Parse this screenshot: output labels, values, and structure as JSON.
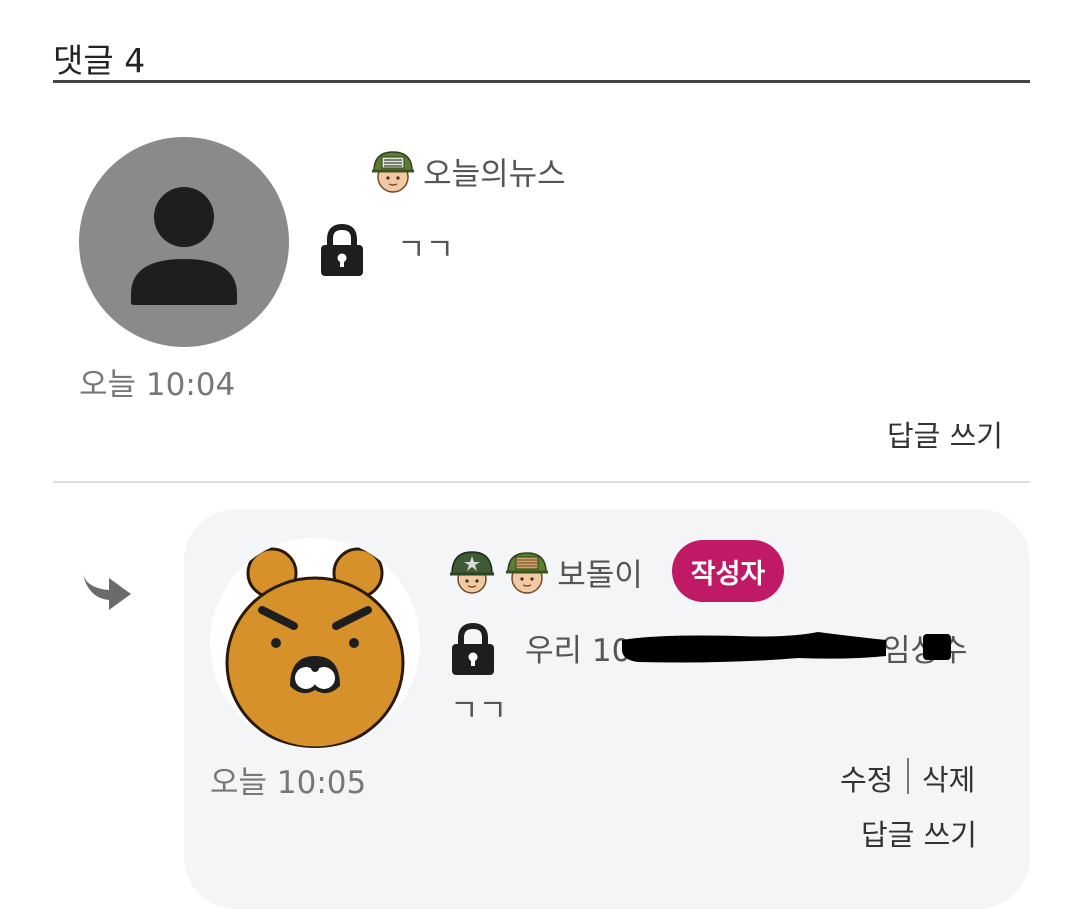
{
  "header": {
    "title": "댓글 4"
  },
  "comments": [
    {
      "nickname": "오늘의뉴스",
      "badge_icons": [
        "soldier-camo-helmet-icon"
      ],
      "secret_icon": "lock-icon",
      "text": "ㄱㄱ",
      "time": "오늘 10:04",
      "reply_label": "답글 쓰기",
      "avatar": "default-user-avatar"
    }
  ],
  "reply": {
    "reply_arrow_icon": "reply-arrow-icon",
    "nickname": "보돌이",
    "badge_icons": [
      "soldier-green-helmet-icon",
      "soldier-camo-helmet-icon"
    ],
    "author_badge": "작성자",
    "secret_icon": "lock-icon",
    "mention": "우리 10",
    "mention_tail": "임상수",
    "text": "ㄱㄱ",
    "time": "오늘 10:05",
    "edit_label": "수정",
    "delete_label": "삭제",
    "reply_label": "답글 쓰기",
    "avatar": "ryan-character-avatar"
  },
  "colors": {
    "author_badge": "#c01a67",
    "reply_bg": "#f4f5f7",
    "avatar_gray": "#8a8a8a",
    "ryan": "#d6912a"
  }
}
